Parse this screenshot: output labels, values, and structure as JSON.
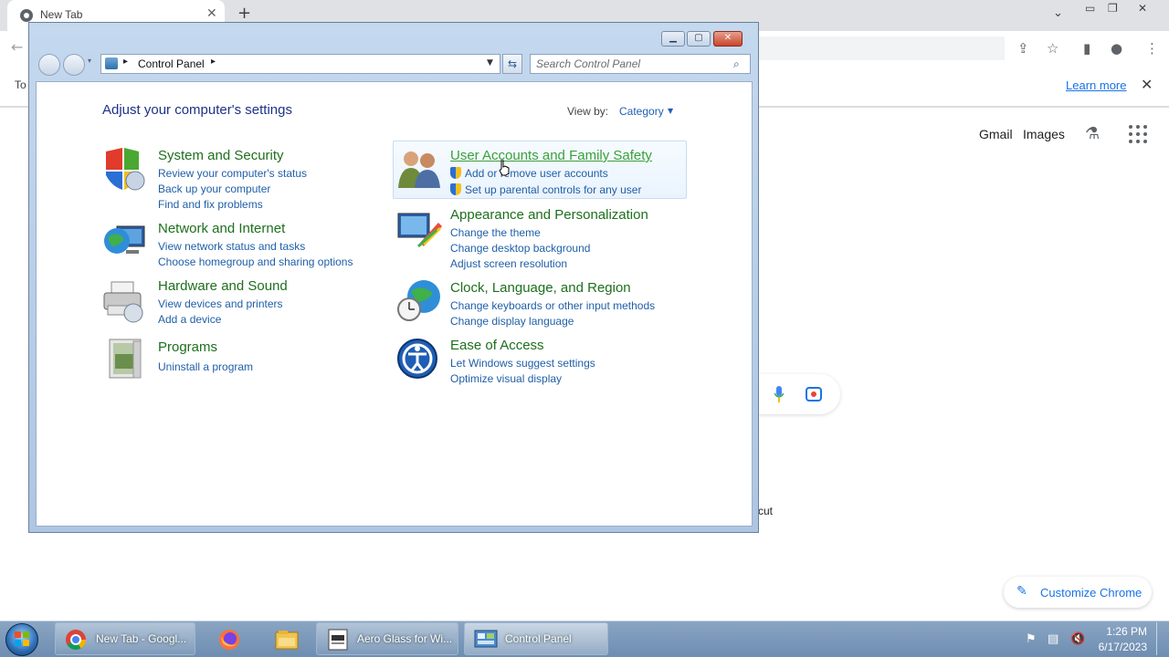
{
  "chrome": {
    "tab_title": "New Tab",
    "infobar_text": "To",
    "learn_more": "Learn more",
    "gmail": "Gmail",
    "images": "Images",
    "shortcut_fragment": "cut",
    "customize": "Customize Chrome"
  },
  "control_panel": {
    "address": "Control Panel",
    "search_placeholder": "Search Control Panel",
    "heading": "Adjust your computer's settings",
    "view_by_label": "View by:",
    "view_by_value": "Category",
    "categories": [
      {
        "title": "System and Security",
        "links": [
          "Review your computer's status",
          "Back up your computer",
          "Find and fix problems"
        ]
      },
      {
        "title": "Network and Internet",
        "links": [
          "View network status and tasks",
          "Choose homegroup and sharing options"
        ]
      },
      {
        "title": "Hardware and Sound",
        "links": [
          "View devices and printers",
          "Add a device"
        ]
      },
      {
        "title": "Programs",
        "links": [
          "Uninstall a program"
        ]
      },
      {
        "title": "User Accounts and Family Safety",
        "links": [
          "Add or remove user accounts",
          "Set up parental controls for any user"
        ]
      },
      {
        "title": "Appearance and Personalization",
        "links": [
          "Change the theme",
          "Change desktop background",
          "Adjust screen resolution"
        ]
      },
      {
        "title": "Clock, Language, and Region",
        "links": [
          "Change keyboards or other input methods",
          "Change display language"
        ]
      },
      {
        "title": "Ease of Access",
        "links": [
          "Let Windows suggest settings",
          "Optimize visual display"
        ]
      }
    ]
  },
  "taskbar": {
    "items": [
      {
        "label": "New Tab - Googl..."
      },
      {
        "label": ""
      },
      {
        "label": ""
      },
      {
        "label": "Aero Glass for Wi..."
      },
      {
        "label": "Control Panel"
      }
    ],
    "time": "1:26 PM",
    "date": "6/17/2023"
  },
  "colors": {
    "category_title": "#1d6f1d",
    "link": "#1f5fa8",
    "heading": "#1e3287",
    "hover_title": "#3aa03a"
  }
}
